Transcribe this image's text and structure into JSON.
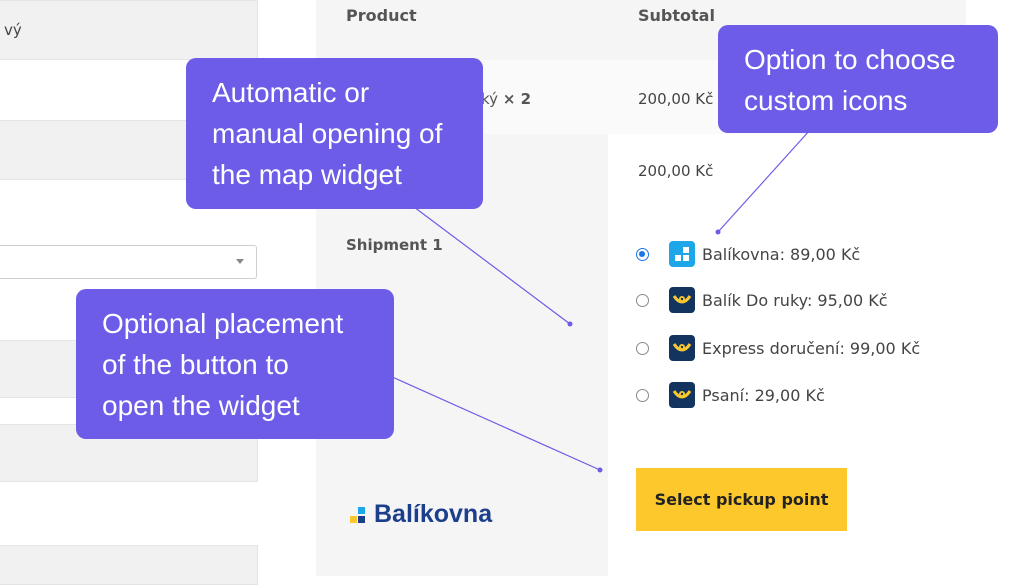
{
  "left_form": {
    "field1_text": "vý"
  },
  "table": {
    "header_product": "Product",
    "header_subtotal": "Subtotal",
    "item_name": "ký",
    "item_qty": "× 2",
    "item_subtotal": "200,00 Kč",
    "cart_subtotal": "200,00 Kč",
    "shipment_label": "Shipment 1"
  },
  "shipping_options": [
    {
      "label": "Balíkovna: 89,00 Kč",
      "icon": "balikovna-icon",
      "checked": true
    },
    {
      "label": "Balík Do ruky: 95,00 Kč",
      "icon": "ceska-posta-horn-icon",
      "checked": false
    },
    {
      "label": "Express doručení: 99,00 Kč",
      "icon": "ceska-posta-horn-icon",
      "checked": false
    },
    {
      "label": "Psaní: 29,00 Kč",
      "icon": "ceska-posta-horn-icon",
      "checked": false
    }
  ],
  "pickup_button": "Select pickup point",
  "brand_text": "Balíkovna",
  "callouts": {
    "map_widget": "Automatic or\nmanual opening of\nthe map widget",
    "custom_icons": "Option to choose\ncustom icons",
    "button_placement": "Optional placement\nof the button to\nopen the widget"
  },
  "colors": {
    "callout": "#6c5ce7",
    "button": "#fcc82c",
    "balikovna_blue": "#1ea7e8",
    "posta_dark": "#12345f",
    "posta_yellow": "#fcc82c"
  }
}
